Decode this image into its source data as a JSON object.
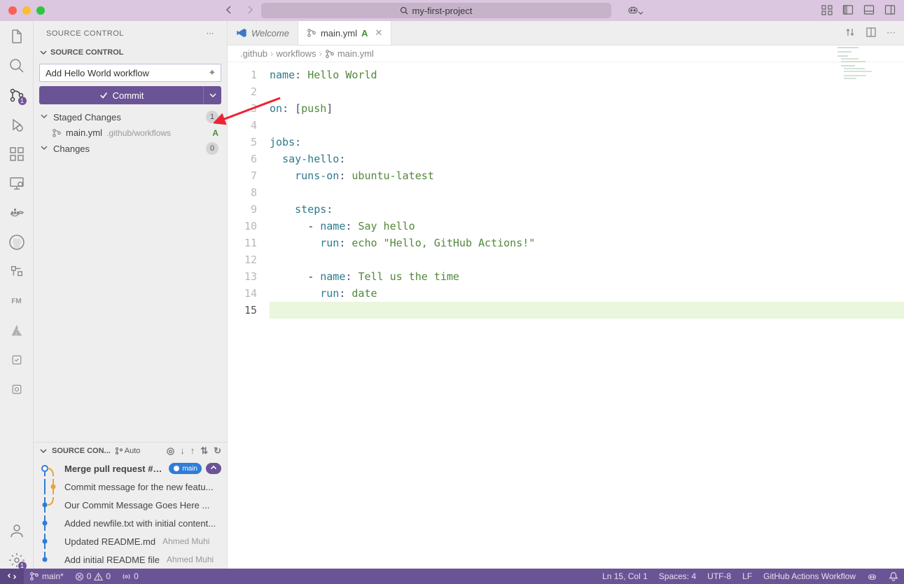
{
  "title": {
    "search_text": "my-first-project"
  },
  "activity": {
    "scm_badge": "1",
    "settings_badge": "1"
  },
  "sidebar": {
    "panel_title": "SOURCE CONTROL",
    "section_title": "SOURCE CONTROL",
    "commit_message": "Add Hello World workflow",
    "commit_button": "Commit",
    "staged_title": "Staged Changes",
    "staged_count": "1",
    "file_name": "main.yml",
    "file_path": ".github/workflows",
    "file_status": "A",
    "changes_title": "Changes",
    "changes_count": "0"
  },
  "graph": {
    "title": "SOURCE CON...",
    "auto_label": "Auto",
    "branch_label": "main",
    "commits": [
      {
        "msg": "Merge pull request #1 ...",
        "author": "",
        "bold": true
      },
      {
        "msg": "Commit message for the new featu...",
        "author": ""
      },
      {
        "msg": "Our Commit Message Goes Here ...",
        "author": ""
      },
      {
        "msg": "Added newfile.txt with initial content...",
        "author": ""
      },
      {
        "msg": "Updated README.md",
        "author": "Ahmed Muhi"
      },
      {
        "msg": "Add initial README file",
        "author": "Ahmed Muhi"
      }
    ]
  },
  "tabs": {
    "welcome": "Welcome",
    "file": "main.yml",
    "file_status": "A"
  },
  "breadcrumb": {
    "p1": ".github",
    "p2": "workflows",
    "p3": "main.yml"
  },
  "code": {
    "lines": [
      {
        "n": "1",
        "tokens": [
          [
            "key",
            "name"
          ],
          [
            "punc",
            ": "
          ],
          [
            "str",
            "Hello World"
          ]
        ]
      },
      {
        "n": "2",
        "tokens": []
      },
      {
        "n": "3",
        "tokens": [
          [
            "key",
            "on"
          ],
          [
            "punc",
            ": ["
          ],
          [
            "str",
            "push"
          ],
          [
            "punc",
            "]"
          ]
        ]
      },
      {
        "n": "4",
        "tokens": []
      },
      {
        "n": "5",
        "tokens": [
          [
            "key",
            "jobs"
          ],
          [
            "punc",
            ":"
          ]
        ]
      },
      {
        "n": "6",
        "tokens": [
          [
            "plain",
            "  "
          ],
          [
            "key",
            "say-hello"
          ],
          [
            "punc",
            ":"
          ]
        ]
      },
      {
        "n": "7",
        "tokens": [
          [
            "plain",
            "    "
          ],
          [
            "key",
            "runs-on"
          ],
          [
            "punc",
            ": "
          ],
          [
            "str",
            "ubuntu-latest"
          ]
        ]
      },
      {
        "n": "8",
        "tokens": []
      },
      {
        "n": "9",
        "tokens": [
          [
            "plain",
            "    "
          ],
          [
            "key",
            "steps"
          ],
          [
            "punc",
            ":"
          ]
        ]
      },
      {
        "n": "10",
        "tokens": [
          [
            "plain",
            "      "
          ],
          [
            "dash",
            "- "
          ],
          [
            "key",
            "name"
          ],
          [
            "punc",
            ": "
          ],
          [
            "str",
            "Say hello"
          ]
        ]
      },
      {
        "n": "11",
        "tokens": [
          [
            "plain",
            "        "
          ],
          [
            "key",
            "run"
          ],
          [
            "punc",
            ": "
          ],
          [
            "str",
            "echo \"Hello, GitHub Actions!\""
          ]
        ]
      },
      {
        "n": "12",
        "tokens": []
      },
      {
        "n": "13",
        "tokens": [
          [
            "plain",
            "      "
          ],
          [
            "dash",
            "- "
          ],
          [
            "key",
            "name"
          ],
          [
            "punc",
            ": "
          ],
          [
            "str",
            "Tell us the time"
          ]
        ]
      },
      {
        "n": "14",
        "tokens": [
          [
            "plain",
            "        "
          ],
          [
            "key",
            "run"
          ],
          [
            "punc",
            ": "
          ],
          [
            "str",
            "date"
          ]
        ]
      },
      {
        "n": "15",
        "tokens": [],
        "current": true,
        "hl": true
      }
    ]
  },
  "status": {
    "branch": "main*",
    "errors": "0",
    "warnings": "0",
    "ports": "0",
    "cursor": "Ln 15, Col 1",
    "spaces": "Spaces: 4",
    "encoding": "UTF-8",
    "eol": "LF",
    "language": "GitHub Actions Workflow"
  }
}
